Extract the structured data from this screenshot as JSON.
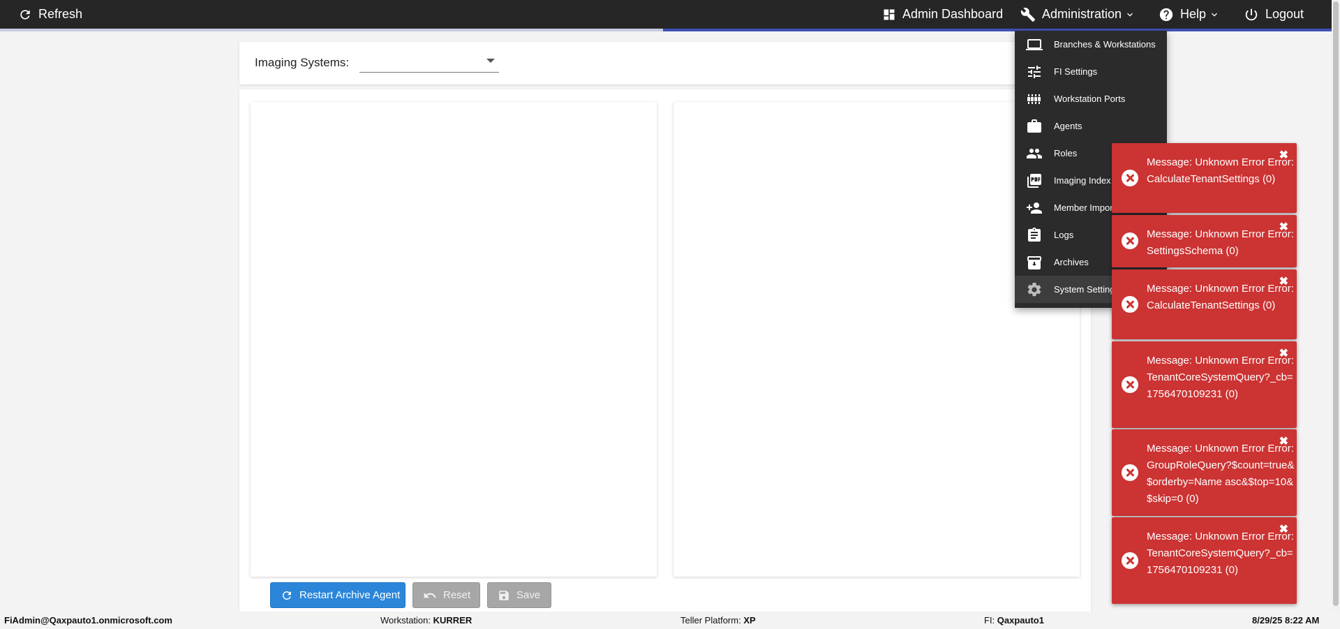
{
  "topbar": {
    "refresh": "Refresh",
    "admin_dashboard": "Admin Dashboard",
    "administration": "Administration",
    "help": "Help",
    "logout": "Logout"
  },
  "imaging": {
    "label": "Imaging Systems:",
    "selected": ""
  },
  "menu": {
    "items": [
      {
        "label": "Branches & Workstations",
        "icon": "laptop-icon"
      },
      {
        "label": "FI Settings",
        "icon": "sliders-icon"
      },
      {
        "label": "Workstation Ports",
        "icon": "ports-icon"
      },
      {
        "label": "Agents",
        "icon": "briefcase-icon"
      },
      {
        "label": "Roles",
        "icon": "people-icon"
      },
      {
        "label": "Imaging Index",
        "icon": "pdf-icon"
      },
      {
        "label": "Member Import",
        "icon": "person-add-icon"
      },
      {
        "label": "Logs",
        "icon": "clipboard-icon"
      },
      {
        "label": "Archives",
        "icon": "archive-icon"
      },
      {
        "label": "System Settings",
        "icon": "gear-icon"
      }
    ]
  },
  "buttons": {
    "restart": "Restart Archive Agent",
    "reset": "Reset",
    "save": "Save"
  },
  "toasts": [
    {
      "text": "Message: Unknown Error Error: CalculateTenantSettings (0)"
    },
    {
      "text": "Message: Unknown Error Error: SettingsSchema (0)"
    },
    {
      "text": "Message: Unknown Error Error: CalculateTenantSettings (0)"
    },
    {
      "text": "Message: Unknown Error Error: TenantCoreSystemQuery?_cb=1756470109231 (0)"
    },
    {
      "text": "Message: Unknown Error Error: GroupRoleQuery?$count=true&$orderby=Name asc&$top=10&$skip=0 (0)"
    },
    {
      "text": "Message: Unknown Error Error: TenantCoreSystemQuery?_cb=1756470109231 (0)"
    }
  ],
  "status": {
    "user": "FiAdmin@Qaxpauto1.onmicrosoft.com",
    "workstation_label": "Workstation:",
    "workstation": "KURRER",
    "platform_label": "Teller Platform:",
    "platform": "XP",
    "fi_label": "FI:",
    "fi": "Qaxpauto1",
    "datetime": "8/29/25 8:22 AM"
  },
  "colors": {
    "topbar": "#262626",
    "accent": "#3f51b5",
    "primary_button": "#2b86d9",
    "toast_error": "#cc3333"
  }
}
